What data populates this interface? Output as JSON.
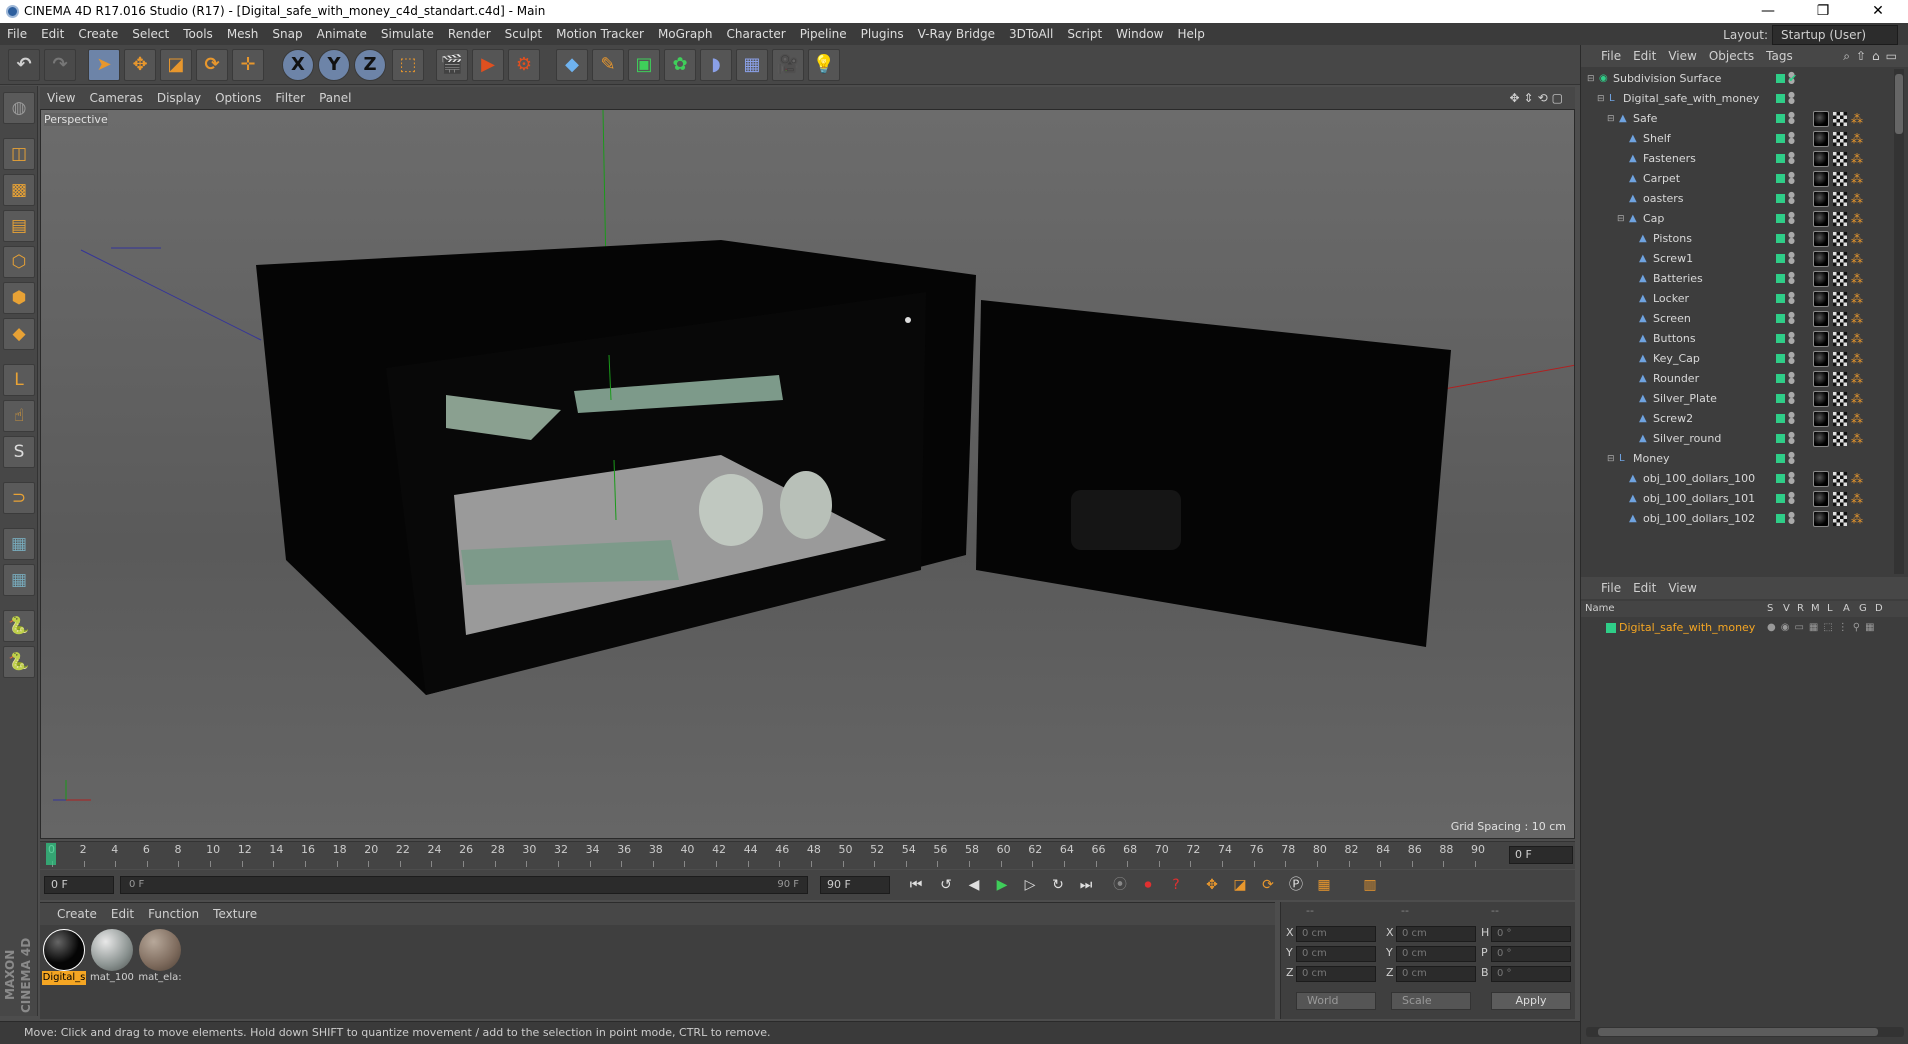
{
  "window": {
    "title": "CINEMA 4D R17.016 Studio (R17) - [Digital_safe_with_money_c4d_standart.c4d] - Main",
    "minimize": "—",
    "restore": "❐",
    "close": "✕"
  },
  "menubar": {
    "items": [
      "File",
      "Edit",
      "Create",
      "Select",
      "Tools",
      "Mesh",
      "Snap",
      "Animate",
      "Simulate",
      "Render",
      "Sculpt",
      "Motion Tracker",
      "MoGraph",
      "Character",
      "Pipeline",
      "Plugins",
      "V-Ray Bridge",
      "3DToAll",
      "Script",
      "Window",
      "Help"
    ],
    "layout_label": "Layout:",
    "layout_value": "Startup (User)"
  },
  "toolbar": {
    "axis_x": "X",
    "axis_y": "Y",
    "axis_z": "Z"
  },
  "viewport": {
    "menu": [
      "View",
      "Cameras",
      "Display",
      "Options",
      "Filter",
      "Panel"
    ],
    "label": "Perspective",
    "grid_spacing": "Grid Spacing : 10 cm",
    "nav_icons": "✥⇕⟲▢"
  },
  "timeline": {
    "ticks": [
      "0",
      "2",
      "4",
      "6",
      "8",
      "10",
      "12",
      "14",
      "16",
      "18",
      "20",
      "22",
      "24",
      "26",
      "28",
      "30",
      "32",
      "34",
      "36",
      "38",
      "40",
      "42",
      "44",
      "46",
      "48",
      "50",
      "52",
      "54",
      "56",
      "58",
      "60",
      "62",
      "64",
      "66",
      "68",
      "70",
      "72",
      "74",
      "76",
      "78",
      "80",
      "82",
      "84",
      "86",
      "88",
      "90"
    ],
    "current_frame": "0 F"
  },
  "transport": {
    "start_field": "0 F",
    "range_start": "0 F",
    "range_end": "90 F",
    "end_field": "90 F"
  },
  "materials": {
    "menu": [
      "Create",
      "Edit",
      "Function",
      "Texture"
    ],
    "items": [
      {
        "name": "Digital_s",
        "selected": true
      },
      {
        "name": "mat_100",
        "selected": false
      },
      {
        "name": "mat_ela:",
        "selected": false
      }
    ]
  },
  "coordinates": {
    "header": [
      "--",
      "--",
      "--"
    ],
    "rows": [
      {
        "l1": "X",
        "v1": "0 cm",
        "l2": "X",
        "v2": "0 cm",
        "l3": "H",
        "v3": "0 °"
      },
      {
        "l1": "Y",
        "v1": "0 cm",
        "l2": "Y",
        "v2": "0 cm",
        "l3": "P",
        "v3": "0 °"
      },
      {
        "l1": "Z",
        "v1": "0 cm",
        "l2": "Z",
        "v2": "0 cm",
        "l3": "B",
        "v3": "0 °"
      }
    ],
    "space": "World",
    "mode": "Scale",
    "apply": "Apply"
  },
  "status": "Move: Click and drag to move elements. Hold down SHIFT to quantize movement / add to the selection in point mode, CTRL to remove.",
  "brand": "MAXON CINEMA 4D",
  "object_manager": {
    "menu": [
      "File",
      "Edit",
      "View",
      "Objects",
      "Tags"
    ],
    "objects": [
      {
        "name": "Subdivision Surface",
        "depth": 0,
        "expander": "⊟",
        "icon": "◉",
        "tags": false
      },
      {
        "name": "Digital_safe_with_money",
        "depth": 1,
        "expander": "⊟",
        "icon": "L",
        "tags": false
      },
      {
        "name": "Safe",
        "depth": 2,
        "expander": "⊟",
        "icon": "▲",
        "tags": true
      },
      {
        "name": "Shelf",
        "depth": 3,
        "expander": "",
        "icon": "▲",
        "tags": true
      },
      {
        "name": "Fasteners",
        "depth": 3,
        "expander": "",
        "icon": "▲",
        "tags": true
      },
      {
        "name": "Carpet",
        "depth": 3,
        "expander": "",
        "icon": "▲",
        "tags": true
      },
      {
        "name": "oasters",
        "depth": 3,
        "expander": "",
        "icon": "▲",
        "tags": true
      },
      {
        "name": "Cap",
        "depth": 3,
        "expander": "⊟",
        "icon": "▲",
        "tags": true
      },
      {
        "name": "Pistons",
        "depth": 4,
        "expander": "",
        "icon": "▲",
        "tags": true
      },
      {
        "name": "Screw1",
        "depth": 4,
        "expander": "",
        "icon": "▲",
        "tags": true
      },
      {
        "name": "Batteries",
        "depth": 4,
        "expander": "",
        "icon": "▲",
        "tags": true
      },
      {
        "name": "Locker",
        "depth": 4,
        "expander": "",
        "icon": "▲",
        "tags": true
      },
      {
        "name": "Screen",
        "depth": 4,
        "expander": "",
        "icon": "▲",
        "tags": true
      },
      {
        "name": "Buttons",
        "depth": 4,
        "expander": "",
        "icon": "▲",
        "tags": true
      },
      {
        "name": "Key_Cap",
        "depth": 4,
        "expander": "",
        "icon": "▲",
        "tags": true
      },
      {
        "name": "Rounder",
        "depth": 4,
        "expander": "",
        "icon": "▲",
        "tags": true
      },
      {
        "name": "Silver_Plate",
        "depth": 4,
        "expander": "",
        "icon": "▲",
        "tags": true
      },
      {
        "name": "Screw2",
        "depth": 4,
        "expander": "",
        "icon": "▲",
        "tags": true
      },
      {
        "name": "Silver_round",
        "depth": 4,
        "expander": "",
        "icon": "▲",
        "tags": true
      },
      {
        "name": "Money",
        "depth": 2,
        "expander": "⊟",
        "icon": "L",
        "tags": false
      },
      {
        "name": "obj_100_dollars_100",
        "depth": 3,
        "expander": "",
        "icon": "▲",
        "tags": true
      },
      {
        "name": "obj_100_dollars_101",
        "depth": 3,
        "expander": "",
        "icon": "▲",
        "tags": true
      },
      {
        "name": "obj_100_dollars_102",
        "depth": 3,
        "expander": "",
        "icon": "▲",
        "tags": true
      }
    ]
  },
  "attribute_manager": {
    "menu": [
      "File",
      "Edit",
      "View"
    ],
    "columns": {
      "name": "Name",
      "s": "S",
      "v": "V",
      "r": "R",
      "m": "M",
      "l": "L",
      "a": "A",
      "g": "G",
      "d": "D"
    },
    "row_name": "Digital_safe_with_money"
  },
  "colors": {
    "accent": "#6d84a8",
    "selected_name": "#f5a623",
    "object_visible": "#2fce88"
  }
}
